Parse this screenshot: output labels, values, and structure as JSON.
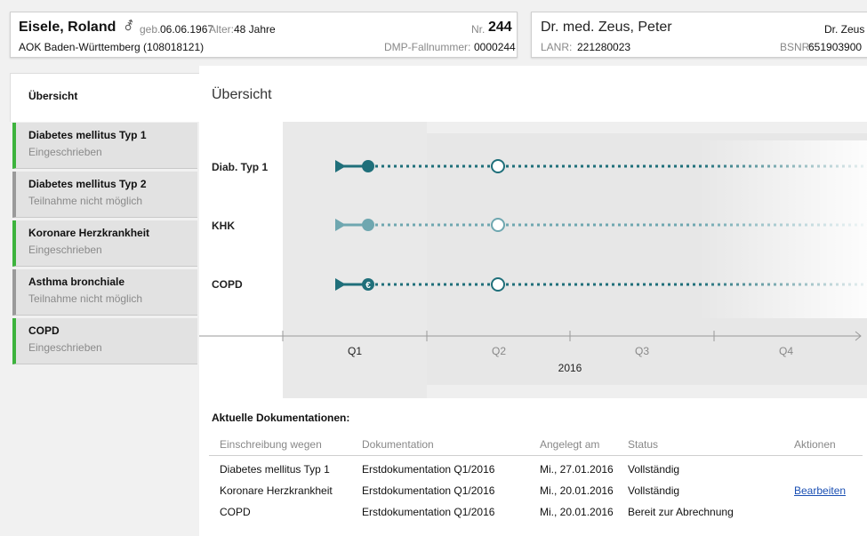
{
  "patient": {
    "name": "Eisele, Roland",
    "gender_icon": "male-symbol-icon",
    "dob_label": "geb.",
    "dob": "06.06.1967",
    "age_label": "Alter:",
    "age": "48 Jahre",
    "insurance": "AOK Baden-Württemberg (108018121)",
    "nr_label": "Nr.",
    "nr": "244",
    "dmp_label": "DMP-Fallnummer:",
    "dmp": "0000244"
  },
  "doctor": {
    "name": "Dr. med. Zeus, Peter",
    "short": "Dr. Zeus",
    "lanr_label": "LANR:",
    "lanr": "221280023",
    "bsnr_label": "BSNR:",
    "bsnr": "651903900"
  },
  "sidebar": {
    "tab": "Übersicht",
    "items": [
      {
        "title": "Diabetes mellitus Typ 1",
        "status": "Eingeschrieben",
        "color": "#3db33d"
      },
      {
        "title": "Diabetes mellitus Typ 2",
        "status": "Teilnahme nicht möglich",
        "color": "#9a9a9a"
      },
      {
        "title": "Koronare Herzkrankheit",
        "status": "Eingeschrieben",
        "color": "#3db33d"
      },
      {
        "title": "Asthma bronchiale",
        "status": "Teilnahme nicht möglich",
        "color": "#9a9a9a"
      },
      {
        "title": "COPD",
        "status": "Eingeschrieben",
        "color": "#3db33d"
      }
    ]
  },
  "main": {
    "title": "Übersicht"
  },
  "timeline": {
    "rows": [
      {
        "label": "Diab. Typ 1",
        "color": "#1f6f7a",
        "marker": "filled"
      },
      {
        "label": "KHK",
        "color": "#6fa7b0",
        "marker": "filled"
      },
      {
        "label": "COPD",
        "color": "#1f6f7a",
        "marker": "euro"
      }
    ],
    "quarters": [
      "Q1",
      "Q2",
      "Q3",
      "Q4"
    ],
    "year": "2016",
    "euro_symbol": "€"
  },
  "docs": {
    "title": "Aktuelle Dokumentationen:",
    "headers": [
      "Einschreibung wegen",
      "Dokumentation",
      "Angelegt am",
      "Status",
      "Aktionen"
    ],
    "rows": [
      {
        "enrollment": "Diabetes mellitus Typ 1",
        "doc": "Erstdokumentation Q1/2016",
        "created": "Mi., 27.01.2016",
        "status": "Vollständig",
        "action": ""
      },
      {
        "enrollment": "Koronare Herzkrankheit",
        "doc": "Erstdokumentation Q1/2016",
        "created": "Mi., 20.01.2016",
        "status": "Vollständig",
        "action": "Bearbeiten"
      },
      {
        "enrollment": "COPD",
        "doc": "Erstdokumentation Q1/2016",
        "created": "Mi., 20.01.2016",
        "status": "Bereit zur Abrechnung",
        "action": ""
      }
    ]
  },
  "colors": {
    "accent": "#1f6f7a",
    "accent_light": "#6fa7b0",
    "enrolled": "#3db33d",
    "not_possible": "#9a9a9a",
    "link": "#1a4fb3"
  }
}
